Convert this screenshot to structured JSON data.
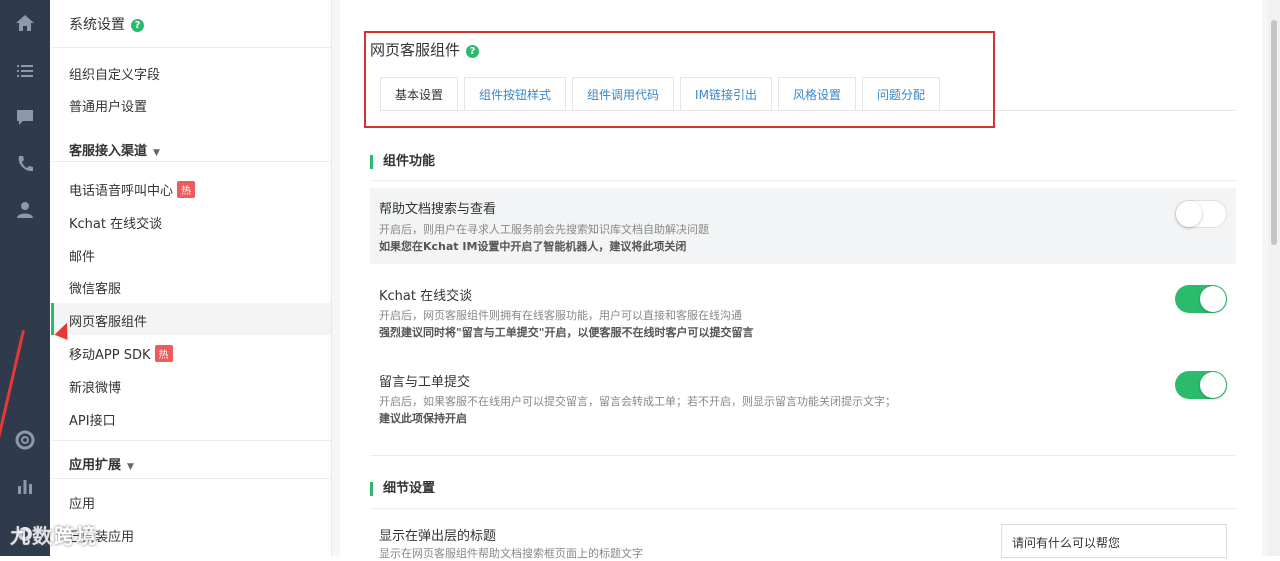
{
  "rail": {
    "icons": [
      "home-icon",
      "list-icon",
      "chat-icon",
      "phone-icon",
      "user-icon",
      "lifebuoy-icon",
      "bar-chart-icon",
      "gear-icon"
    ]
  },
  "menu": {
    "title": "系统设置",
    "help": "?",
    "items_top": [
      "组织自定义字段",
      "普通用户设置"
    ],
    "section1": "客服接入渠道",
    "channels": [
      "电话语音呼叫中心",
      "Kchat 在线交谈",
      "邮件",
      "微信客服",
      "网页客服组件",
      "移动APP SDK",
      "新浪微博",
      "API接口"
    ],
    "hot": "热",
    "section2": "应用扩展",
    "apps": [
      "应用",
      "已安装应用"
    ],
    "watermark": "九数跨境"
  },
  "page": {
    "title": "网页客服组件",
    "tabs": [
      "基本设置",
      "组件按钮样式",
      "组件调用代码",
      "IM链接引出",
      "风格设置",
      "问题分配"
    ],
    "section_func": "组件功能",
    "rows": [
      {
        "title": "帮助文档搜索与查看",
        "desc": "开启后，则用户在寻求人工服务前会先搜索知识库文档自助解决问题",
        "note": "如果您在Kchat IM设置中开启了智能机器人，建议将此项关闭",
        "enabled": false
      },
      {
        "title": "Kchat 在线交谈",
        "desc": "开启后，网页客服组件则拥有在线客服功能，用户可以直接和客服在线沟通",
        "note": "强烈建议同时将\"留言与工单提交\"开启，以便客服不在线时客户可以提交留言",
        "enabled": true
      },
      {
        "title": "留言与工单提交",
        "desc": "开启后，如果客服不在线用户可以提交留言，留言会转成工单；若不开启，则显示留言功能关闭提示文字；",
        "note": "建议此项保持开启",
        "enabled": true
      }
    ],
    "section_detail": "细节设置",
    "detail_title": "显示在弹出层的标题",
    "detail_desc": "显示在网页客服组件帮助文档搜索框页面上的标题文字",
    "detail_input": "请问有什么可以帮您"
  },
  "colors": {
    "accent": "#2cb96d",
    "rail": "#2f3b4c",
    "highlight": "#d9312f",
    "hot": "#f05a5a",
    "link": "#3a87c8"
  }
}
